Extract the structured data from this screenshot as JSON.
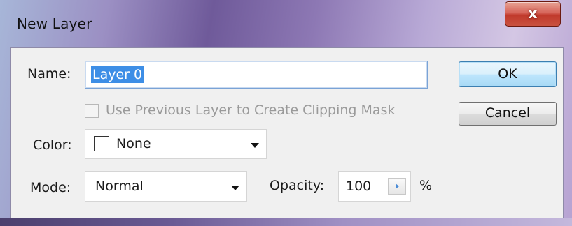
{
  "window": {
    "title": "New Layer",
    "close_label": "x"
  },
  "form": {
    "name_label": "Name:",
    "name_value": "Layer 0",
    "clipping_mask_label": "Use Previous Layer to Create Clipping Mask",
    "clipping_mask_checked": false,
    "clipping_mask_enabled": false,
    "color_label": "Color:",
    "color_value": "None",
    "mode_label": "Mode:",
    "mode_value": "Normal",
    "opacity_label": "Opacity:",
    "opacity_value": "100",
    "opacity_unit": "%"
  },
  "buttons": {
    "ok_label": "OK",
    "cancel_label": "Cancel"
  },
  "colors": {
    "selection": "#3d8ee6",
    "default_button_border": "#3c7fb1",
    "close_button": "#c0392b"
  }
}
